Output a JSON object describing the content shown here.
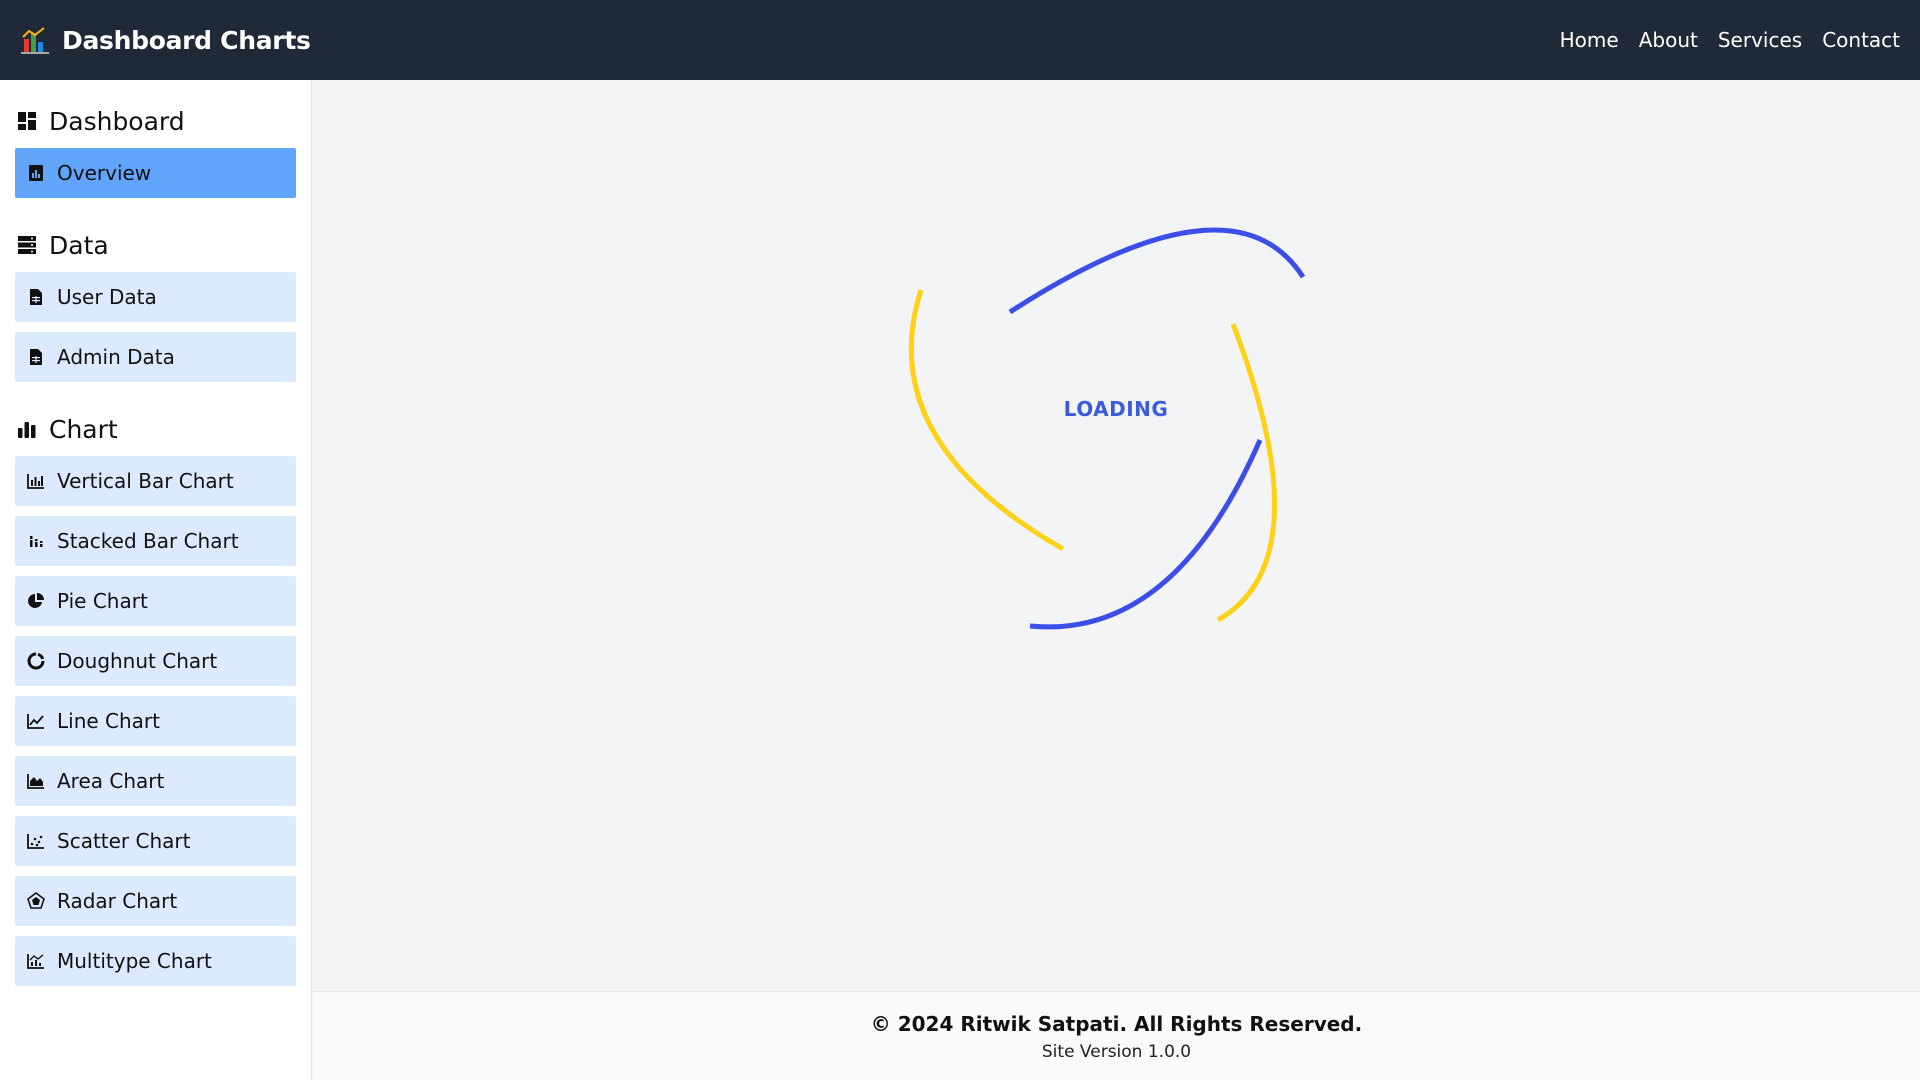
{
  "header": {
    "title": "Dashboard Charts",
    "logo_icon": "chart-logo-icon",
    "nav": [
      "Home",
      "About",
      "Services",
      "Contact"
    ]
  },
  "sidebar": {
    "sections": [
      {
        "title": "Dashboard",
        "icon": "dashboard-icon",
        "items": [
          {
            "label": "Overview",
            "icon": "overview-icon",
            "active": true
          }
        ]
      },
      {
        "title": "Data",
        "icon": "database-icon",
        "items": [
          {
            "label": "User Data",
            "icon": "file-table-icon"
          },
          {
            "label": "Admin Data",
            "icon": "file-table-icon"
          }
        ]
      },
      {
        "title": "Chart",
        "icon": "bar-chart-icon",
        "items": [
          {
            "label": "Vertical Bar Chart",
            "icon": "vertical-bar-chart-icon"
          },
          {
            "label": "Stacked Bar Chart",
            "icon": "stacked-bar-chart-icon"
          },
          {
            "label": "Pie Chart",
            "icon": "pie-chart-icon"
          },
          {
            "label": "Doughnut Chart",
            "icon": "doughnut-chart-icon"
          },
          {
            "label": "Line Chart",
            "icon": "line-chart-icon"
          },
          {
            "label": "Area Chart",
            "icon": "area-chart-icon"
          },
          {
            "label": "Scatter Chart",
            "icon": "scatter-chart-icon"
          },
          {
            "label": "Radar Chart",
            "icon": "radar-chart-icon"
          },
          {
            "label": "Multitype Chart",
            "icon": "multitype-chart-icon"
          }
        ]
      }
    ]
  },
  "main": {
    "loading_text": "LOADING",
    "spinner_colors": {
      "blue": "#3b4ee8",
      "yellow": "#fcd116"
    }
  },
  "footer": {
    "copyright": "© 2024 Ritwik Satpati. All Rights Reserved.",
    "version": "Site Version 1.0.0"
  },
  "colors": {
    "topbar": "#1f2937",
    "active_item": "#60a5fa",
    "item": "#dbeafe"
  }
}
